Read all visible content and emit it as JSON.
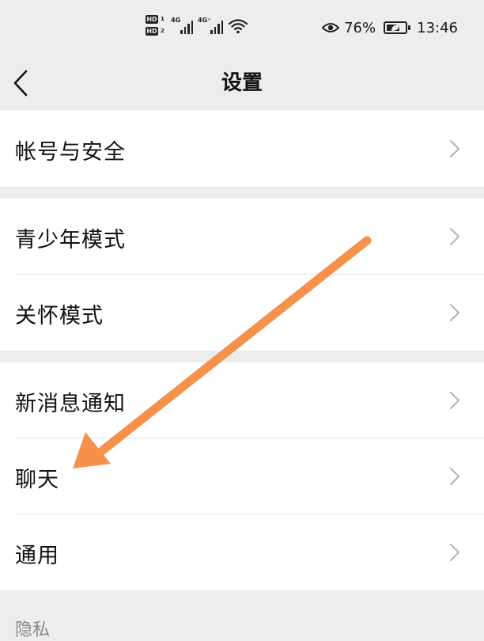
{
  "status_bar": {
    "hd_badge": "HD",
    "hd_sub_1": "1",
    "hd_sub_2": "2",
    "signal_1": "4G",
    "signal_2": "4G⁺",
    "battery_percent": "76%",
    "battery_level": 0.76,
    "time": "13:46",
    "icons": [
      "signal-bars-icon",
      "wifi-icon",
      "eye-icon",
      "battery-icon"
    ]
  },
  "nav": {
    "title": "设置",
    "back_icon": "chevron-left-icon"
  },
  "groups": [
    {
      "items": [
        {
          "label": "帐号与安全"
        }
      ]
    },
    {
      "items": [
        {
          "label": "青少年模式"
        },
        {
          "label": "关怀模式"
        }
      ]
    },
    {
      "items": [
        {
          "label": "新消息通知"
        },
        {
          "label": "聊天"
        },
        {
          "label": "通用"
        }
      ]
    }
  ],
  "section_label": "隐私",
  "colors": {
    "background": "#ededed",
    "card": "#ffffff",
    "arrow": "#f5914a",
    "chevron": "#b2b2b2"
  }
}
